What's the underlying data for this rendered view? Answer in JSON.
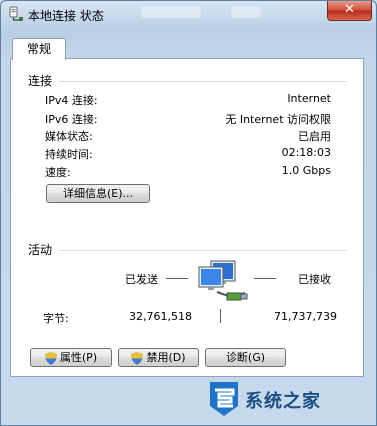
{
  "window": {
    "title": "本地连接 状态",
    "close_label": "✕"
  },
  "tabs": [
    {
      "label": "常规"
    }
  ],
  "connection": {
    "section_label": "连接",
    "rows": [
      {
        "label": "IPv4 连接:",
        "value": "Internet"
      },
      {
        "label": "IPv6 连接:",
        "value": "无 Internet 访问权限"
      },
      {
        "label": "媒体状态:",
        "value": "已启用"
      },
      {
        "label": "持续时间:",
        "value": "02:18:03"
      },
      {
        "label": "速度:",
        "value": "1.0 Gbps"
      }
    ],
    "details_button": "详细信息(E)..."
  },
  "activity": {
    "section_label": "活动",
    "sent_label": "已发送",
    "received_label": "已接收",
    "bytes_label": "字节:",
    "sent_value": "32,761,518",
    "received_value": "71,737,739"
  },
  "buttons": {
    "properties": "属性(P)",
    "disable": "禁用(D)",
    "diagnose": "诊断(G)"
  },
  "watermark": {
    "text": "系统之家"
  },
  "colors": {
    "accent": "#1a4e84",
    "close": "#c8412e"
  }
}
